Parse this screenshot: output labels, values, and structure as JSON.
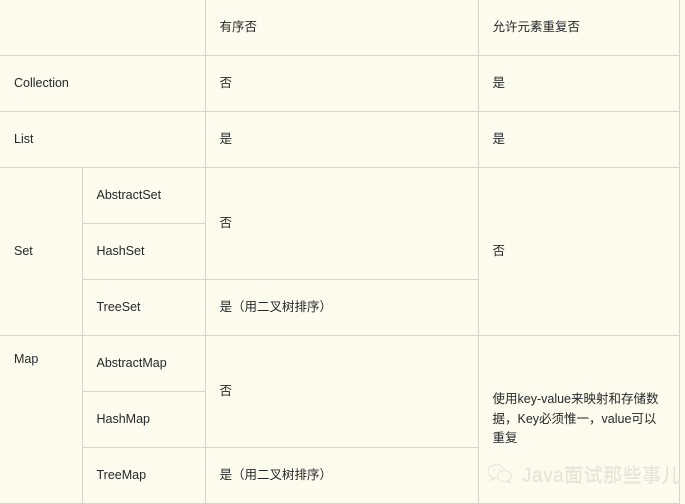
{
  "table": {
    "columns": [
      "",
      "",
      "有序否",
      "允许元素重复否"
    ],
    "header": {
      "col1": "",
      "col2": "",
      "ordered": "有序否",
      "duplicates": "允许元素重复否"
    },
    "rows": [
      {
        "group": "Collection",
        "subtype": "",
        "ordered": "否",
        "duplicates": "是"
      },
      {
        "group": "List",
        "subtype": "",
        "ordered": "是",
        "duplicates": "是"
      },
      {
        "group": "Set",
        "subtypes": [
          "AbstractSet",
          "HashSet",
          "TreeSet"
        ],
        "ordered_merged": "否",
        "ordered_treeset": "是（用二叉树排序）",
        "duplicates": "否"
      },
      {
        "group": "Map",
        "subtypes": [
          "AbstractMap",
          "HashMap",
          "TreeMap"
        ],
        "ordered_merged": "否",
        "ordered_treemap": "是（用二叉树排序）",
        "duplicates": "使用key-value来映射和存储数据，Key必须惟一，value可以重复"
      }
    ]
  },
  "watermark": {
    "icon": "wechat-icon",
    "text": "Java面试那些事儿"
  },
  "colors": {
    "background": "#fbfbee",
    "border": "#d5d5c8",
    "text": "#26282a",
    "watermark_text": "#dcdccb"
  }
}
